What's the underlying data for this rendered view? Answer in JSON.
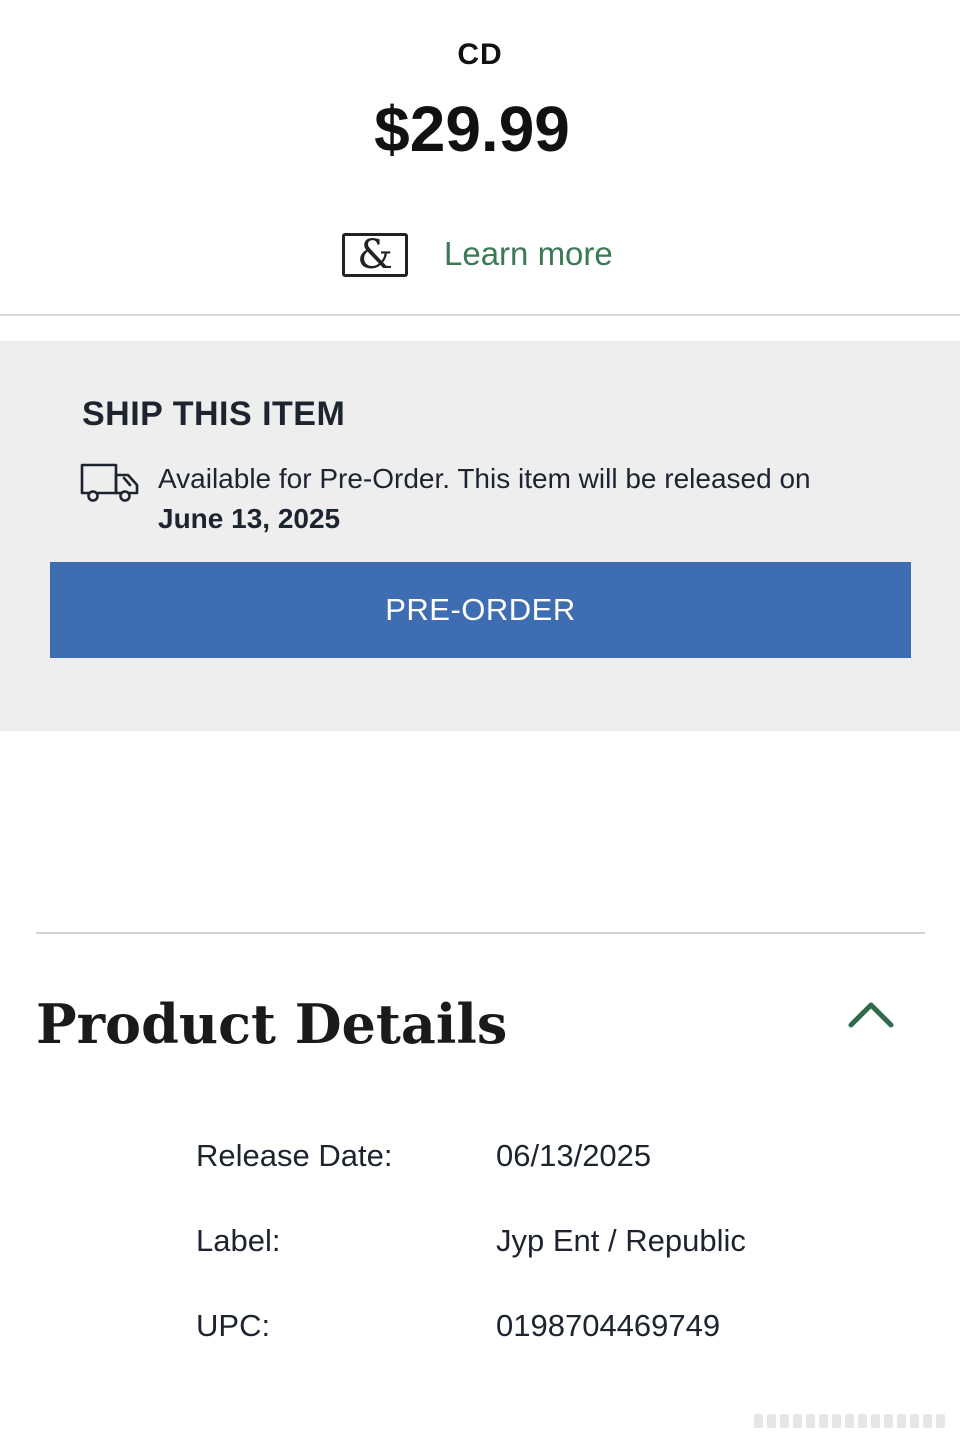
{
  "product": {
    "format": "CD",
    "price": "$29.99"
  },
  "membership": {
    "logo_glyph": "&",
    "learn_more_label": "Learn more",
    "link_color": "#3a7a55"
  },
  "shipping": {
    "heading": "SHIP THIS ITEM",
    "icon": "truck-icon",
    "availability_text": "Available for Pre-Order. This item will be released on",
    "release_date": "June 13, 2025",
    "button_label": "PRE-ORDER",
    "button_color": "#3f6db2"
  },
  "details": {
    "title": "Product Details",
    "toggle_icon": "chevron-up-icon",
    "rows": [
      {
        "label": "Release Date:",
        "value": "06/13/2025"
      },
      {
        "label": "Label:",
        "value": "Jyp Ent / Republic"
      },
      {
        "label": "UPC:",
        "value": "0198704469749"
      }
    ]
  }
}
